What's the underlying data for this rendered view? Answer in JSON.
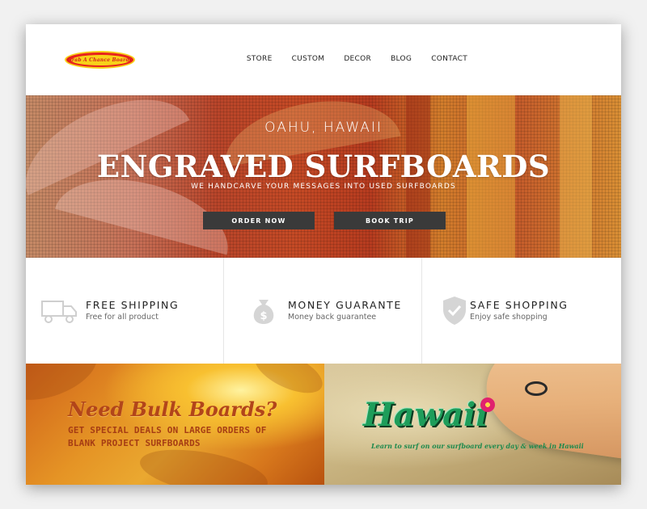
{
  "brand": {
    "logo_text": "Grab A Chance Boards",
    "colors": {
      "logo_red": "#e8231d",
      "logo_yellow": "#f7d21a"
    }
  },
  "nav": {
    "items": [
      {
        "label": "STORE"
      },
      {
        "label": "CUSTOM"
      },
      {
        "label": "DECOR"
      },
      {
        "label": "BLOG"
      },
      {
        "label": "CONTACT"
      }
    ]
  },
  "hero": {
    "location": "OAHU, HAWAII",
    "title": "ENGRAVED SURFBOARDS",
    "subtitle": "WE HANDCARVE YOUR MESSAGES INTO USED SURFBOARDS",
    "primary_button": "ORDER NOW",
    "secondary_button": "BOOK TRIP",
    "button_color": "#3a3a3a"
  },
  "features": [
    {
      "icon": "truck-icon",
      "title": "FREE SHIPPING",
      "text": "Free for all product"
    },
    {
      "icon": "money-bag-icon",
      "title": "MONEY GUARANTE",
      "text": "Money back guarantee"
    },
    {
      "icon": "shield-check-icon",
      "title": "SAFE SHOPPING",
      "text": "Enjoy safe shopping"
    }
  ],
  "promo": {
    "bulk": {
      "heading": "Need Bulk Boards?",
      "line1": "GET SPECIAL DEALS ON LARGE ORDERS OF",
      "line2": "BLANK PROJECT SURFBOARDS"
    },
    "hawaii": {
      "heading": "Hawaii",
      "tagline": "Learn to surf on our surfboard every day & week in Hawaii"
    }
  }
}
